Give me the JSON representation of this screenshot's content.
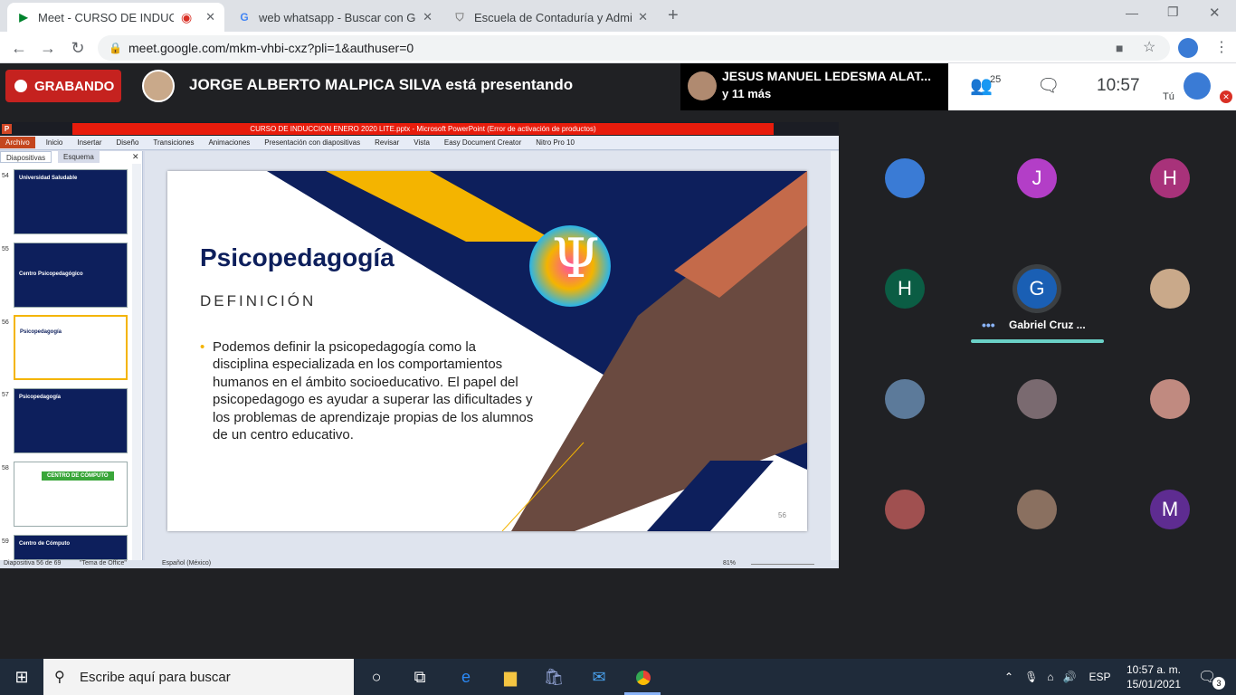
{
  "tabs": [
    {
      "label": "Meet - CURSO DE INDUCCIO",
      "recording": true
    },
    {
      "label": "web whatsapp - Buscar con Goo"
    },
    {
      "label": "Escuela de Contaduría y Adminis"
    }
  ],
  "url": "meet.google.com/mkm-vhbi-cxz?pli=1&authuser=0",
  "meet": {
    "recording_label": "GRABANDO",
    "presenting_text": "JORGE ALBERTO MALPICA SILVA está presentando",
    "pinned_name": "JESUS MANUEL LEDESMA ALAT...",
    "pinned_more": "y 11 más",
    "participant_count": "25",
    "time": "10:57",
    "self_label": "Tú"
  },
  "ppt": {
    "window_title": "CURSO DE INDUCCION ENERO 2020 LITE.pptx - Microsoft PowerPoint (Error de activación de productos)",
    "ribbon": [
      "Archivo",
      "Inicio",
      "Insertar",
      "Diseño",
      "Transiciones",
      "Animaciones",
      "Presentación con diapositivas",
      "Revisar",
      "Vista",
      "Easy Document Creator",
      "Nitro Pro 10"
    ],
    "pane_tabs": [
      "Diapositivas",
      "Esquema"
    ],
    "thumbs": [
      {
        "num": "54",
        "title": "Universidad Saludable"
      },
      {
        "num": "55",
        "title": "Centro Psicopedagógico"
      },
      {
        "num": "56",
        "title": "Psicopedagogía"
      },
      {
        "num": "57",
        "title": "Psicopedagogía"
      },
      {
        "num": "58",
        "title": "CENTRO DE CÓMPUTO"
      },
      {
        "num": "59",
        "title": "Centro de Cómputo"
      }
    ],
    "slide": {
      "title": "Psicopedagogía",
      "subtitle": "DEFINICIÓN",
      "body": "Podemos definir la psicopedagogía como la disciplina especializada en los comportamientos humanos en el ámbito socioeducativo. El papel del psicopedagogo es ayudar a superar las dificultades y los problemas de aprendizaje propias de los alumnos de un centro educativo.",
      "number": "56"
    },
    "status": {
      "slide": "Diapositiva 56 de 69",
      "theme": "\"Tema de Office\"",
      "lang": "Español (México)",
      "zoom": "81%"
    }
  },
  "participants": [
    {
      "initial": "",
      "color": "#3a7bd5"
    },
    {
      "initial": "J",
      "color": "#b33ec7"
    },
    {
      "initial": "H",
      "color": "#a8327a"
    },
    {
      "initial": "H",
      "color": "#0b5d44"
    },
    {
      "initial": "G",
      "color": "#1a5fb4",
      "name": "Gabriel Cruz ..."
    },
    {
      "initial": "",
      "color": "#c9a98a"
    },
    {
      "initial": "",
      "color": "#5c7a9a"
    },
    {
      "initial": "",
      "color": "#7a6a70"
    },
    {
      "initial": "",
      "color": "#c08a80"
    },
    {
      "initial": "",
      "color": "#a05050"
    },
    {
      "initial": "",
      "color": "#8a7060"
    },
    {
      "initial": "M",
      "color": "#5e2c91"
    }
  ],
  "taskbar": {
    "search_placeholder": "Escribe aquí para buscar",
    "lang": "ESP",
    "time": "10:57 a. m.",
    "date": "15/01/2021",
    "notifications": "3"
  }
}
